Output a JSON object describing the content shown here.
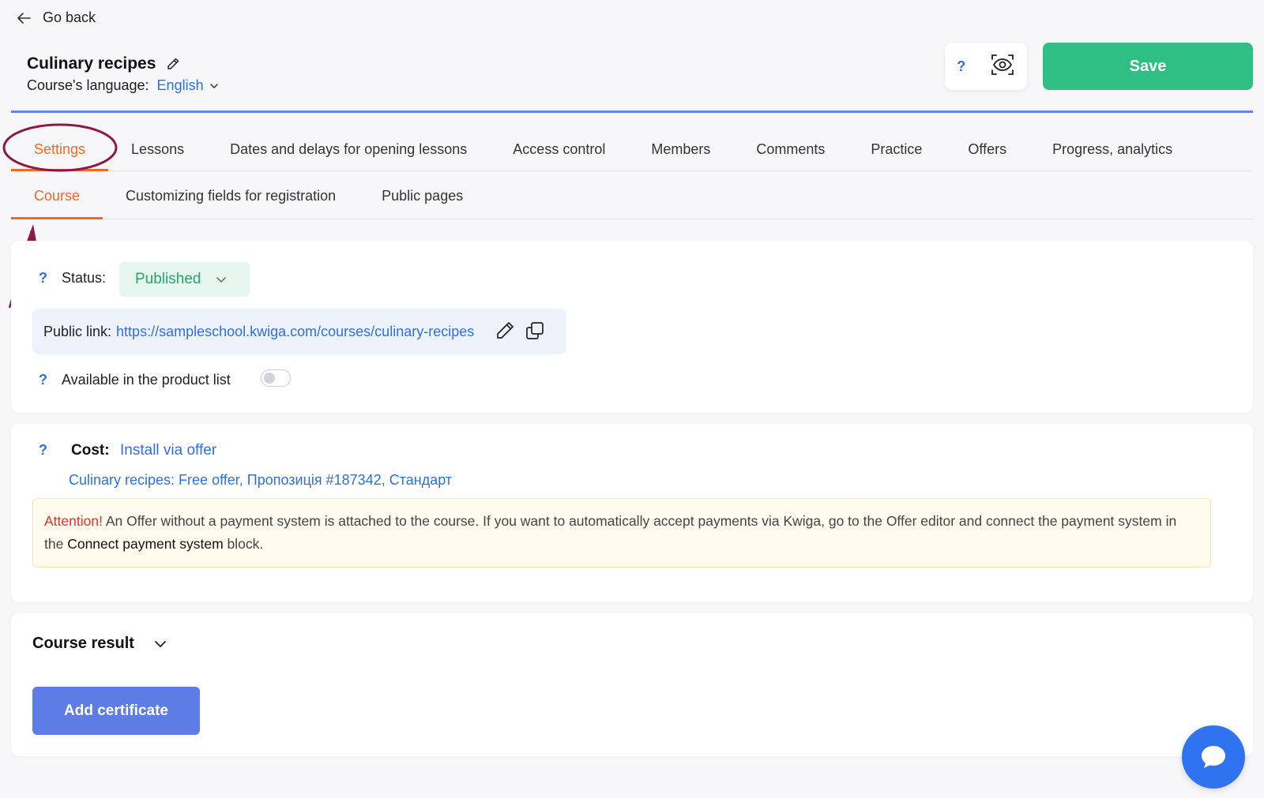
{
  "nav": {
    "back_label": "Go back"
  },
  "header": {
    "title": "Culinary recipes",
    "language_label": "Course's language:",
    "language_value": "English",
    "help_label": "?",
    "save_label": "Save"
  },
  "tabs": [
    {
      "label": "Settings",
      "active": true
    },
    {
      "label": "Lessons"
    },
    {
      "label": "Dates and delays for opening lessons"
    },
    {
      "label": "Access control"
    },
    {
      "label": "Members"
    },
    {
      "label": "Comments"
    },
    {
      "label": "Practice"
    },
    {
      "label": "Offers"
    },
    {
      "label": "Progress, analytics"
    }
  ],
  "subtabs": [
    {
      "label": "Course",
      "active": true
    },
    {
      "label": "Customizing fields for registration"
    },
    {
      "label": "Public pages"
    }
  ],
  "status_card": {
    "help": "?",
    "status_label": "Status:",
    "status_value": "Published",
    "public_link_label": "Public link:",
    "public_link_url": "https://sampleschool.kwiga.com/courses/culinary-recipes",
    "available_label": "Available in the product list",
    "available_enabled": false
  },
  "cost_card": {
    "help": "?",
    "cost_label": "Cost:",
    "cost_value": "Install via offer",
    "offer_link": "Culinary recipes: Free offer, Пропозиція #187342, Стандарт",
    "attention_prefix": "Attention!",
    "attention_text": " An Offer without a payment system is attached to the course. If you want to automatically accept payments via Kwiga, go to the Offer editor and connect the payment system in the ",
    "attention_bold": "Connect payment system",
    "attention_suffix": " block."
  },
  "result_card": {
    "title": "Course result",
    "add_certificate_label": "Add certificate"
  },
  "colors": {
    "accent_orange": "#ef6a2a",
    "save_green": "#2fbf85",
    "link_blue": "#2f6fe4",
    "annotation": "#8b1a4a"
  }
}
